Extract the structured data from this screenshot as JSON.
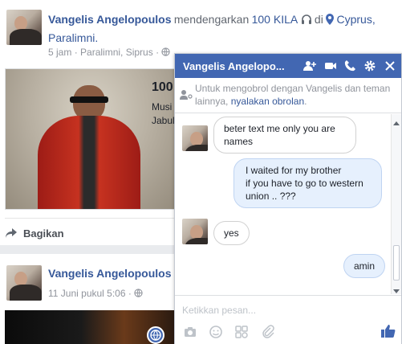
{
  "post1": {
    "author": "Vangelis Angelopoulos",
    "activity": "mendengarkan",
    "song": "100 KILA",
    "preposition": "di",
    "location_line1": "Cyprus,",
    "location_line2": "Paralimni.",
    "time": "5 jam",
    "place": "Paralimni, Siprus",
    "card_title": "100",
    "card_line1": "Musi",
    "card_line2": "Jabul",
    "share_label": "Bagikan"
  },
  "post2": {
    "author": "Vangelis Angelopoulos",
    "time": "11 Juni pukul 5:06"
  },
  "chat": {
    "title": "Vangelis Angelopo...",
    "notice_text": "Untuk mengobrol dengan Vangelis dan teman lainnya,",
    "notice_link": "nyalakan obrolan",
    "notice_end": ".",
    "messages": [
      {
        "direction": "in",
        "line1": "beter text me only you are",
        "line2": "names"
      },
      {
        "direction": "out",
        "line1": "I waited for my brother",
        "line2": "if you have to go to western",
        "line3": "union .. ???"
      },
      {
        "direction": "in",
        "line1": "yes"
      },
      {
        "direction": "out",
        "line1": "amin"
      }
    ],
    "composer_placeholder": "Ketikkan pesan..."
  },
  "colors": {
    "brand": "#4267b2",
    "link": "#365899",
    "outgoing_bubble": "#e6f0fd"
  },
  "icons": [
    "headphones-icon",
    "location-pin-icon",
    "globe-icon",
    "share-icon",
    "add-friend-icon",
    "video-call-icon",
    "phone-icon",
    "gear-icon",
    "close-icon",
    "chat-off-icon",
    "camera-icon",
    "emoji-icon",
    "sticker-icon",
    "attach-icon",
    "like-icon"
  ]
}
